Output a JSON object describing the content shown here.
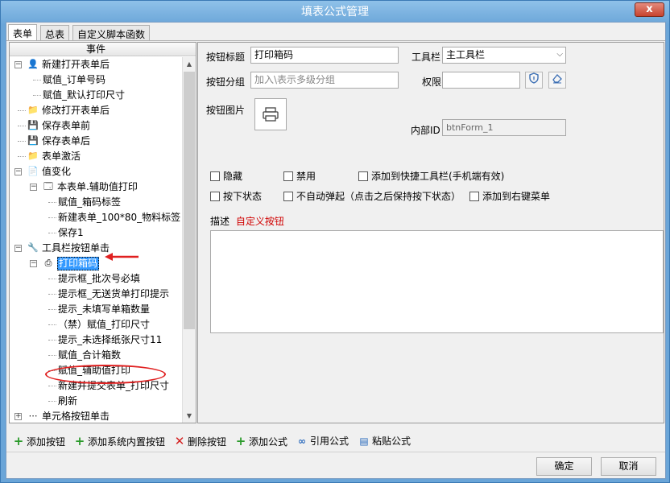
{
  "window": {
    "title": "填表公式管理",
    "close_label": "x"
  },
  "tabs": [
    {
      "label": "表单",
      "active": true
    },
    {
      "label": "总表",
      "active": false
    },
    {
      "label": "自定义脚本函数",
      "active": false
    }
  ],
  "left_panel": {
    "header": "事件",
    "tree": [
      {
        "id": "n1",
        "label": "新建打开表单后",
        "icon": "user-icon",
        "expander": "−"
      },
      {
        "id": "n2",
        "label": "赋值_订单号码",
        "icon": ""
      },
      {
        "id": "n3",
        "label": "赋值_默认打印尺寸",
        "icon": ""
      },
      {
        "id": "n4",
        "label": "修改打开表单后",
        "icon": "folder-icon"
      },
      {
        "id": "n5",
        "label": "保存表单前",
        "icon": "save-icon"
      },
      {
        "id": "n6",
        "label": "保存表单后",
        "icon": "save-icon"
      },
      {
        "id": "n7",
        "label": "表单激活",
        "icon": "folder-icon"
      },
      {
        "id": "n8",
        "label": "值变化",
        "icon": "document-icon",
        "expander": "−"
      },
      {
        "id": "n9",
        "label": "本表单.辅助值打印",
        "icon": "form-icon",
        "expander": "−"
      },
      {
        "id": "n10",
        "label": "赋值_箱码标签",
        "icon": ""
      },
      {
        "id": "n11",
        "label": "新建表单_100*80_物料标签",
        "icon": ""
      },
      {
        "id": "n12",
        "label": "保存1",
        "icon": ""
      },
      {
        "id": "n13",
        "label": "工具栏按钮单击",
        "icon": "wrench-icon",
        "expander": "−"
      },
      {
        "id": "n14",
        "label": "打印箱码",
        "icon": "printer-icon",
        "expander": "−",
        "selected": true
      },
      {
        "id": "n15",
        "label": "提示框_批次号必填",
        "icon": ""
      },
      {
        "id": "n16",
        "label": "提示框_无送货单打印提示",
        "icon": ""
      },
      {
        "id": "n17",
        "label": "提示_未填写单箱数量",
        "icon": ""
      },
      {
        "id": "n18",
        "label": "（禁）赋值_打印尺寸",
        "icon": ""
      },
      {
        "id": "n19",
        "label": "提示_未选择纸张尺寸11",
        "icon": ""
      },
      {
        "id": "n20",
        "label": "赋值_合计箱数",
        "icon": ""
      },
      {
        "id": "n21",
        "label": "赋值_辅助值打印",
        "icon": "",
        "circled": true
      },
      {
        "id": "n22",
        "label": "新建并提交表单_打印尺寸",
        "icon": ""
      },
      {
        "id": "n23",
        "label": "刷新",
        "icon": ""
      },
      {
        "id": "n24",
        "label": "单元格按钮单击",
        "icon": "dots-icon",
        "expander": "+"
      }
    ]
  },
  "form": {
    "button_title_label": "按钮标题",
    "button_title_value": "打印箱码",
    "toolbar_label": "工具栏",
    "toolbar_value": "主工具栏",
    "button_group_label": "按钮分组",
    "button_group_placeholder": "加入\\表示多级分组",
    "permission_label": "权限",
    "permission_value": "",
    "button_image_label": "按钮图片",
    "internal_id_label": "内部ID",
    "internal_id_value": "btnForm_1",
    "checkboxes": [
      {
        "label": "隐藏",
        "checked": false
      },
      {
        "label": "禁用",
        "checked": false
      },
      {
        "label": "添加到快捷工具栏(手机端有效)",
        "checked": false
      },
      {
        "label": "按下状态",
        "checked": false
      },
      {
        "label": "不自动弹起（点击之后保持按下状态）",
        "checked": false
      },
      {
        "label": "添加到右键菜单",
        "checked": false
      }
    ],
    "description_label": "描述",
    "description_value": "自定义按钮",
    "description_text": ""
  },
  "toolbar": {
    "add_button": "添加按钮",
    "add_system_button": "添加系统内置按钮",
    "delete_button": "删除按钮",
    "add_formula": "添加公式",
    "reference_formula": "引用公式",
    "paste_formula": "粘贴公式"
  },
  "footer": {
    "ok": "确定",
    "cancel": "取消"
  },
  "colors": {
    "accent": "#3399ff",
    "annotation_red": "#e02020",
    "description_red": "#d00000"
  }
}
